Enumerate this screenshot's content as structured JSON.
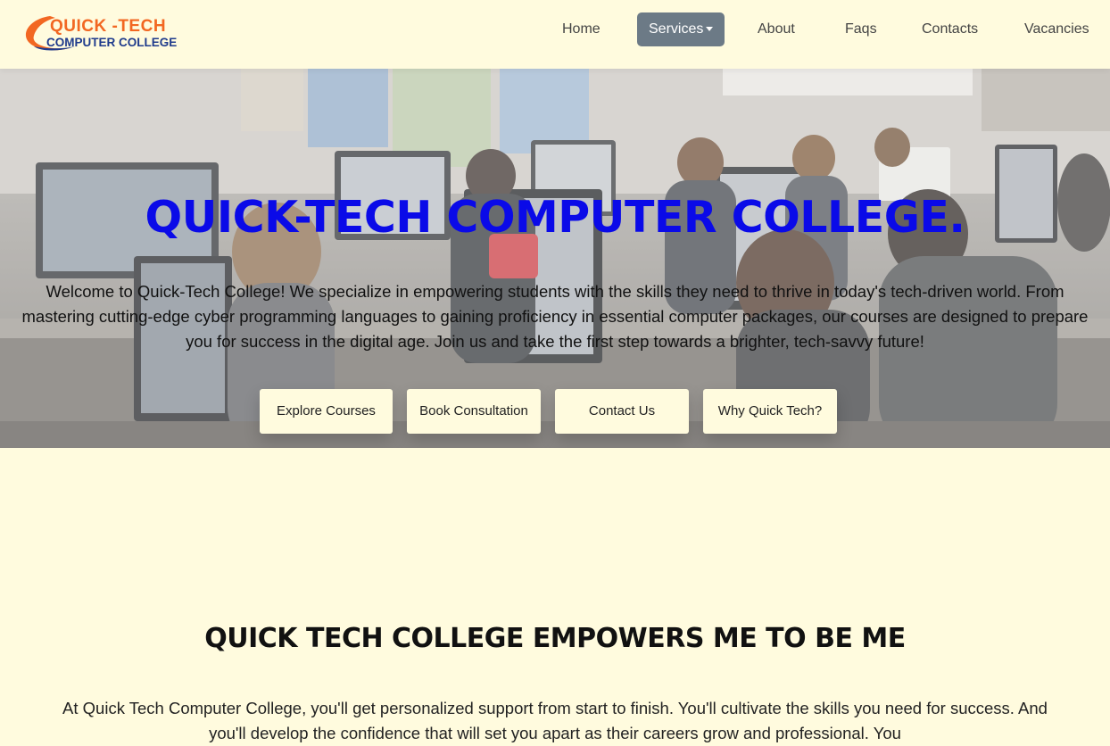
{
  "brand": {
    "name_line1": "QUICK -TECH",
    "name_line2": "COMPUTER COLLEGE",
    "logo_icon": "swoosh-logo-icon",
    "colors": {
      "orange": "#f26722",
      "blue": "#1f3b8c"
    }
  },
  "nav": {
    "items": [
      {
        "label": "Home"
      },
      {
        "label": "Services",
        "active": true,
        "has_dropdown": true
      },
      {
        "label": "About"
      },
      {
        "label": "Faqs"
      },
      {
        "label": "Contacts"
      },
      {
        "label": "Vacancies"
      }
    ]
  },
  "hero": {
    "title": "QUICK-TECH COMPUTER COLLEGE.",
    "title_color": "#0a0ae8",
    "intro": "Welcome to Quick-Tech College! We specialize in empowering students with the skills they need to thrive in today's tech-driven world. From mastering cutting-edge cyber programming languages to gaining proficiency in essential computer packages, our courses are designed to prepare you for success in the digital age. Join us and take the first step towards a brighter, tech-savvy future!",
    "buttons": [
      {
        "label": "Explore Courses"
      },
      {
        "label": "Book Consultation"
      },
      {
        "label": "Contact Us"
      },
      {
        "label": "Why Quick Tech?"
      }
    ]
  },
  "empower": {
    "title": "QUICK TECH COLLEGE EMPOWERS ME TO BE ME",
    "text": "At Quick Tech Computer College, you'll get personalized support from start to finish. You'll cultivate the skills you need for success. And you'll develop the confidence that will set you apart as their careers grow and professional. You"
  },
  "theme": {
    "page_background": "#fffbde",
    "active_nav_background": "#6c7a86"
  }
}
